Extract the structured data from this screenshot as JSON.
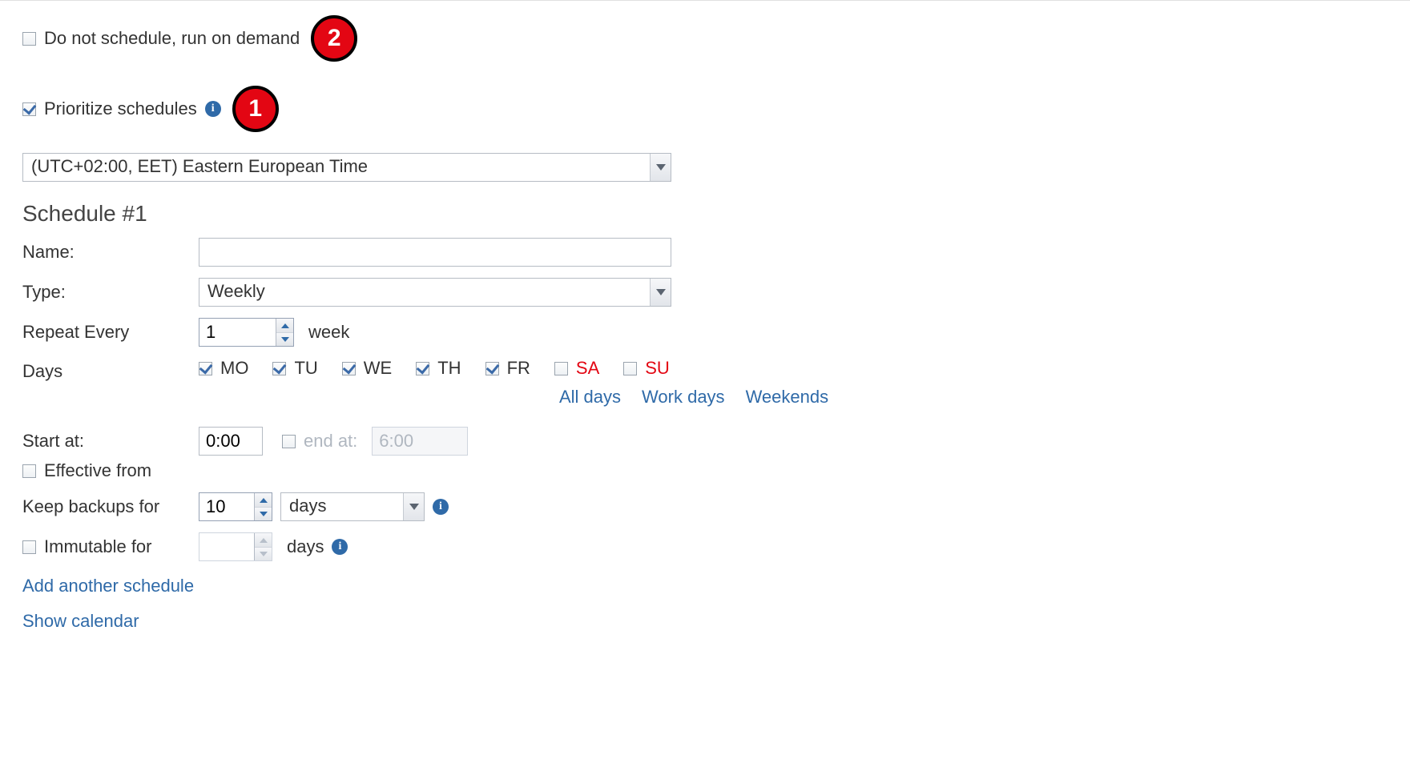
{
  "top": {
    "no_schedule_label": "Do not schedule, run on demand",
    "no_schedule_checked": false,
    "prioritize_label": "Prioritize schedules",
    "prioritize_checked": true,
    "callout_1": "1",
    "callout_2": "2"
  },
  "timezone": {
    "value_label": "(UTC+02:00, EET) Eastern European Time"
  },
  "schedule": {
    "heading": "Schedule #1",
    "name_label": "Name:",
    "name_value": "",
    "type_label": "Type:",
    "type_value": "Weekly",
    "repeat_label": "Repeat Every",
    "repeat_value": "1",
    "repeat_unit": "week",
    "days_label": "Days",
    "days": [
      {
        "code": "MO",
        "checked": true,
        "weekend": false
      },
      {
        "code": "TU",
        "checked": true,
        "weekend": false
      },
      {
        "code": "WE",
        "checked": true,
        "weekend": false
      },
      {
        "code": "TH",
        "checked": true,
        "weekend": false
      },
      {
        "code": "FR",
        "checked": true,
        "weekend": false
      },
      {
        "code": "SA",
        "checked": false,
        "weekend": true
      },
      {
        "code": "SU",
        "checked": false,
        "weekend": true
      }
    ],
    "day_links": {
      "all": "All days",
      "work": "Work days",
      "weekends": "Weekends"
    },
    "start_label": "Start at:",
    "start_value": "0:00",
    "end_enabled": false,
    "end_label": "end at:",
    "end_value": "6:00",
    "effective_from_label": "Effective from",
    "effective_from_checked": false,
    "keep_label": "Keep backups for",
    "keep_value": "10",
    "keep_unit": "days",
    "immutable_label": "Immutable for",
    "immutable_checked": false,
    "immutable_value": "",
    "immutable_unit": "days"
  },
  "links": {
    "add": "Add another schedule",
    "calendar": "Show calendar"
  }
}
